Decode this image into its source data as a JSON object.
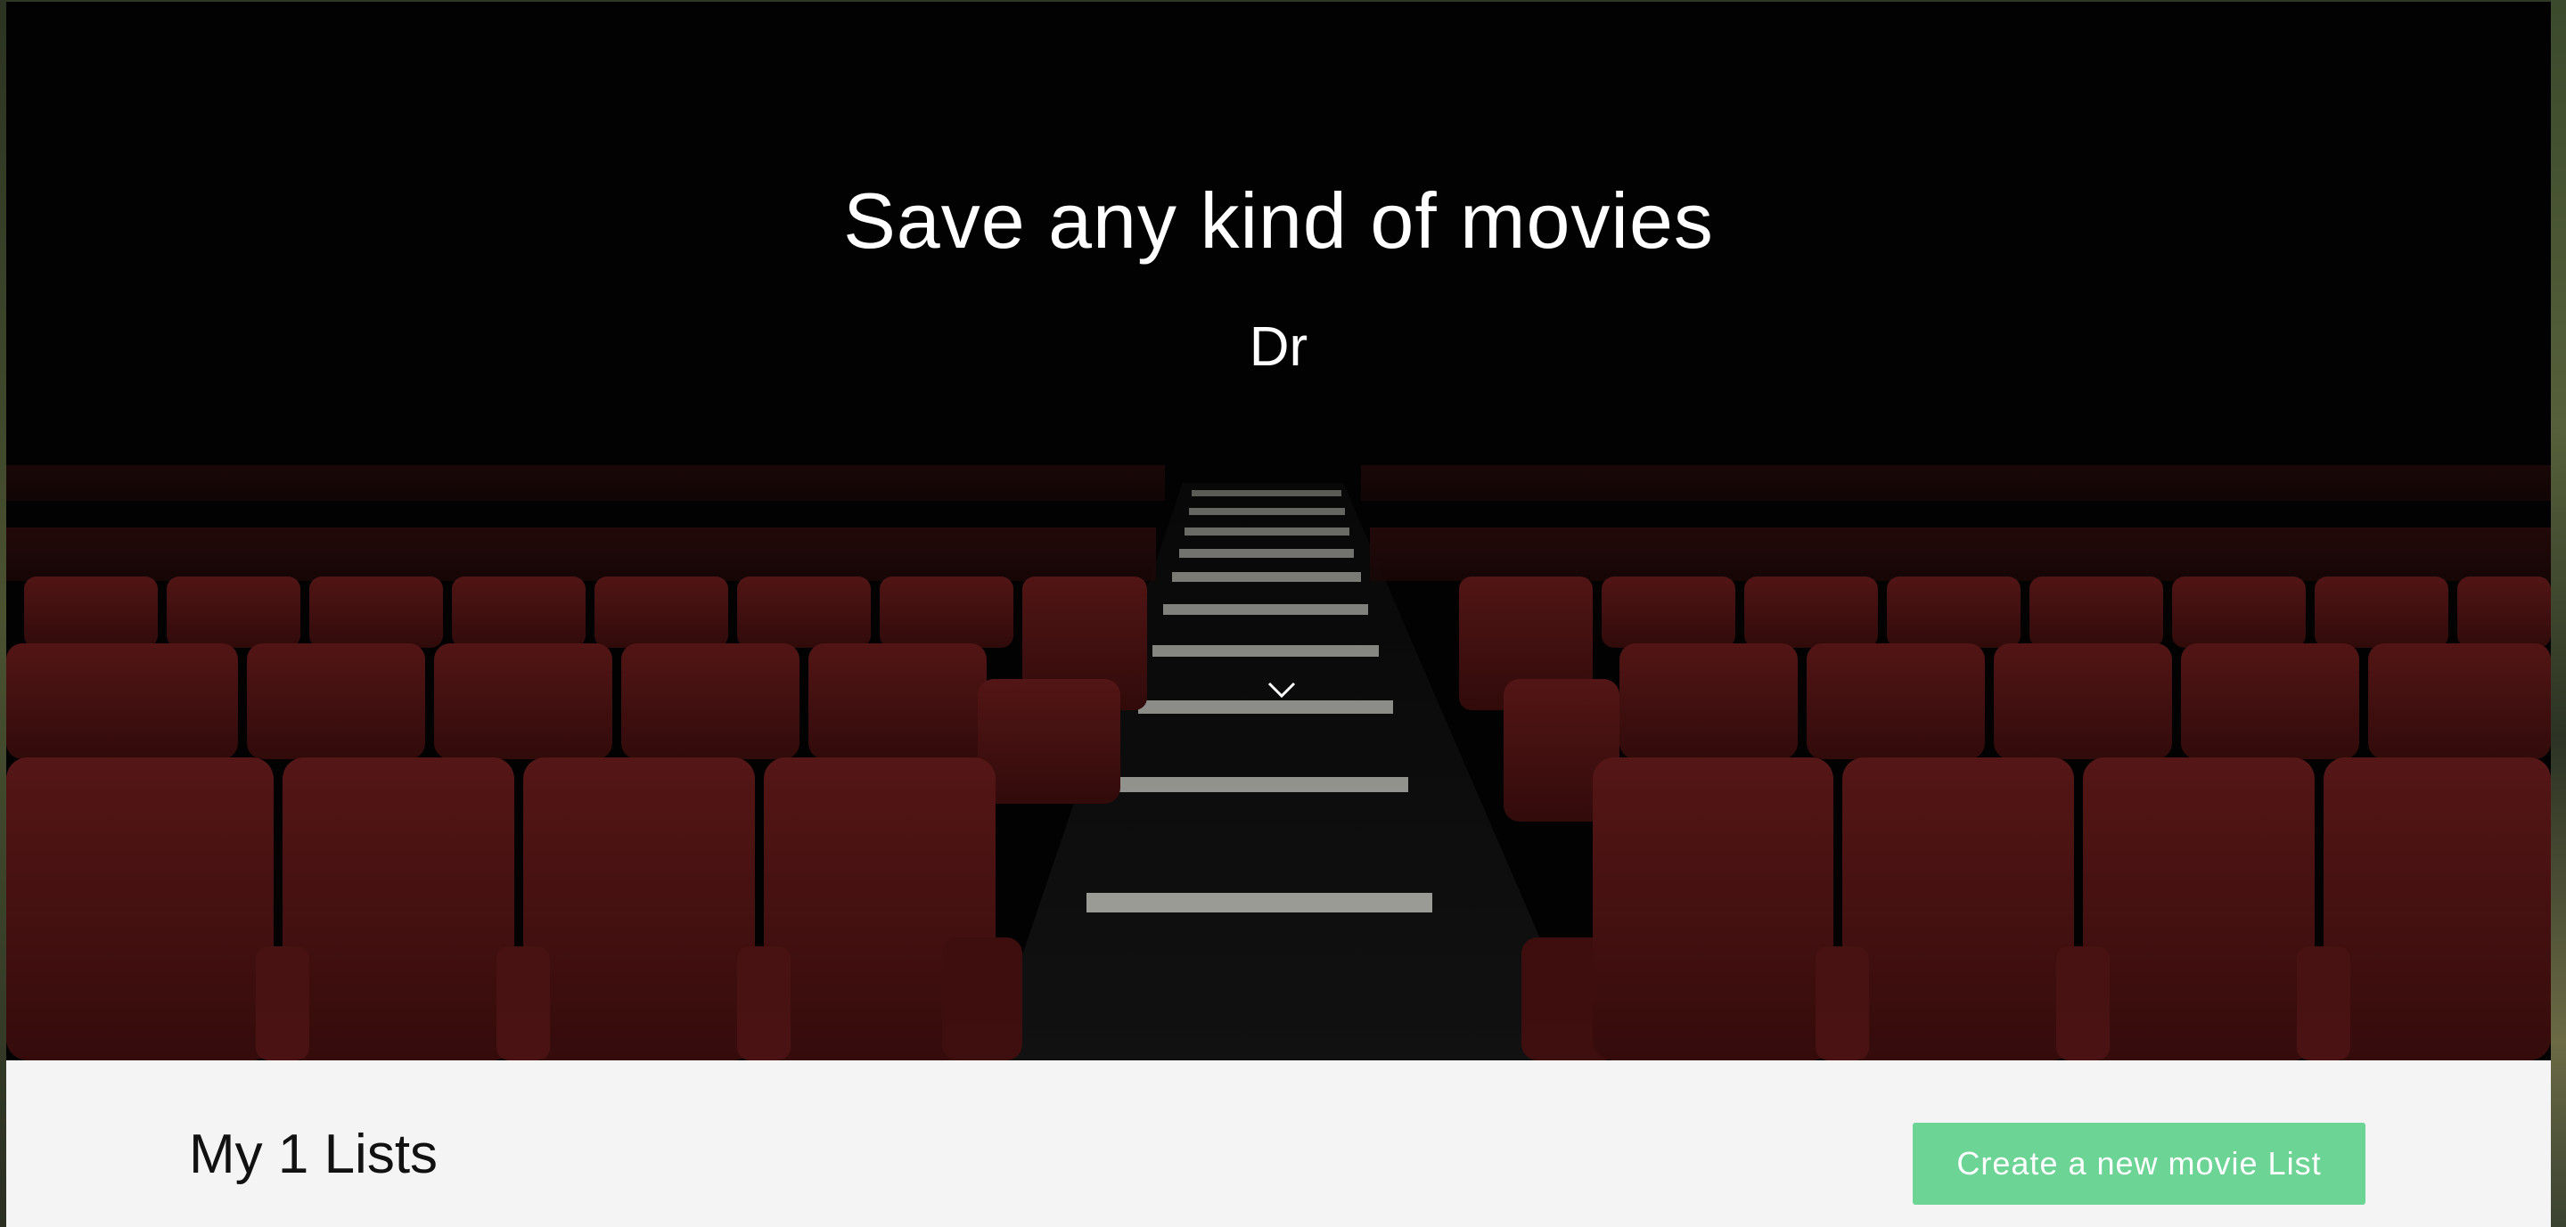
{
  "hero": {
    "title": "Save any kind of movies",
    "subtitle": "Dr",
    "scroll_icon": "chevron-down-icon",
    "background_image": "theater-seats-photo"
  },
  "lists": {
    "heading": "My 1 Lists",
    "create_button_label": "Create a new movie List"
  },
  "colors": {
    "accent": "#6cd495",
    "seat_red": "#5e1616",
    "hero_bg": "#030303",
    "page_bg": "#f4f4f4"
  }
}
